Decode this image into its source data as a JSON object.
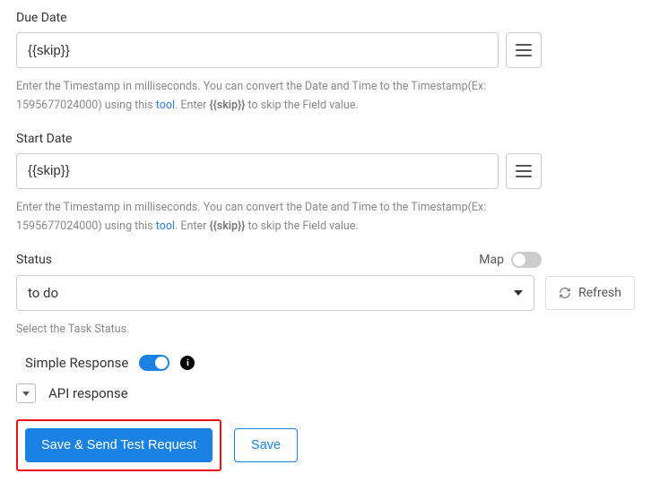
{
  "dueDate": {
    "label": "Due Date",
    "value": "{{skip}}",
    "help_pre": "Enter the Timestamp in milliseconds. You can convert the Date and Time to the Timestamp(Ex: 1595677024000) using this ",
    "help_link": "tool",
    "help_mid": ". Enter ",
    "help_skip": "{{skip}}",
    "help_post": " to skip the Field value."
  },
  "startDate": {
    "label": "Start Date",
    "value": "{{skip}}",
    "help_pre": "Enter the Timestamp in milliseconds. You can convert the Date and Time to the Timestamp(Ex: 1595677024000) using this ",
    "help_link": "tool",
    "help_mid": ". Enter ",
    "help_skip": "{{skip}}",
    "help_post": " to skip the Field value."
  },
  "status": {
    "label": "Status",
    "map_label": "Map",
    "value": "to do",
    "help": "Select the Task Status.",
    "refresh_label": "Refresh"
  },
  "simpleResponse": {
    "label": "Simple Response",
    "on": true
  },
  "apiResponse": {
    "label": "API response"
  },
  "buttons": {
    "saveSend": "Save & Send Test Request",
    "save": "Save"
  }
}
